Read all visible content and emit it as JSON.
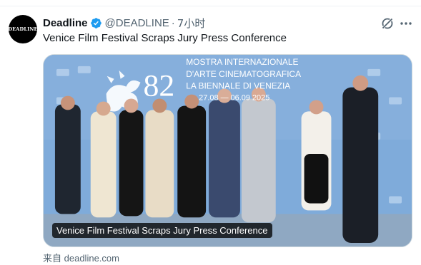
{
  "tweet": {
    "author": {
      "display_name": "Deadline",
      "handle": "@DEADLINE",
      "avatar_text": "DEADLINE",
      "verified": true
    },
    "separator": "·",
    "time_ago": "7小时",
    "text": "Venice Film Festival Scraps Jury Press Conference",
    "card": {
      "caption": "Venice Film Festival Scraps Jury Press Conference",
      "backdrop_title_lines": [
        "MOSTRA INTERNAZIONALE",
        "D'ARTE CINEMATOGRAFICA",
        "LA BIENNALE DI VENEZIA"
      ],
      "backdrop_dates": "27.08 — 06.09 2025",
      "backdrop_number": "82"
    },
    "source": {
      "prefix": "来自",
      "domain": "deadline.com"
    }
  },
  "icons": {
    "verified": "verified-badge-icon",
    "grok": "grok-icon",
    "more": "more-dots-icon"
  },
  "colors": {
    "verified_blue": "#1d9bf0",
    "secondary_text": "#536471",
    "backdrop_blue": "#7da9d9"
  }
}
